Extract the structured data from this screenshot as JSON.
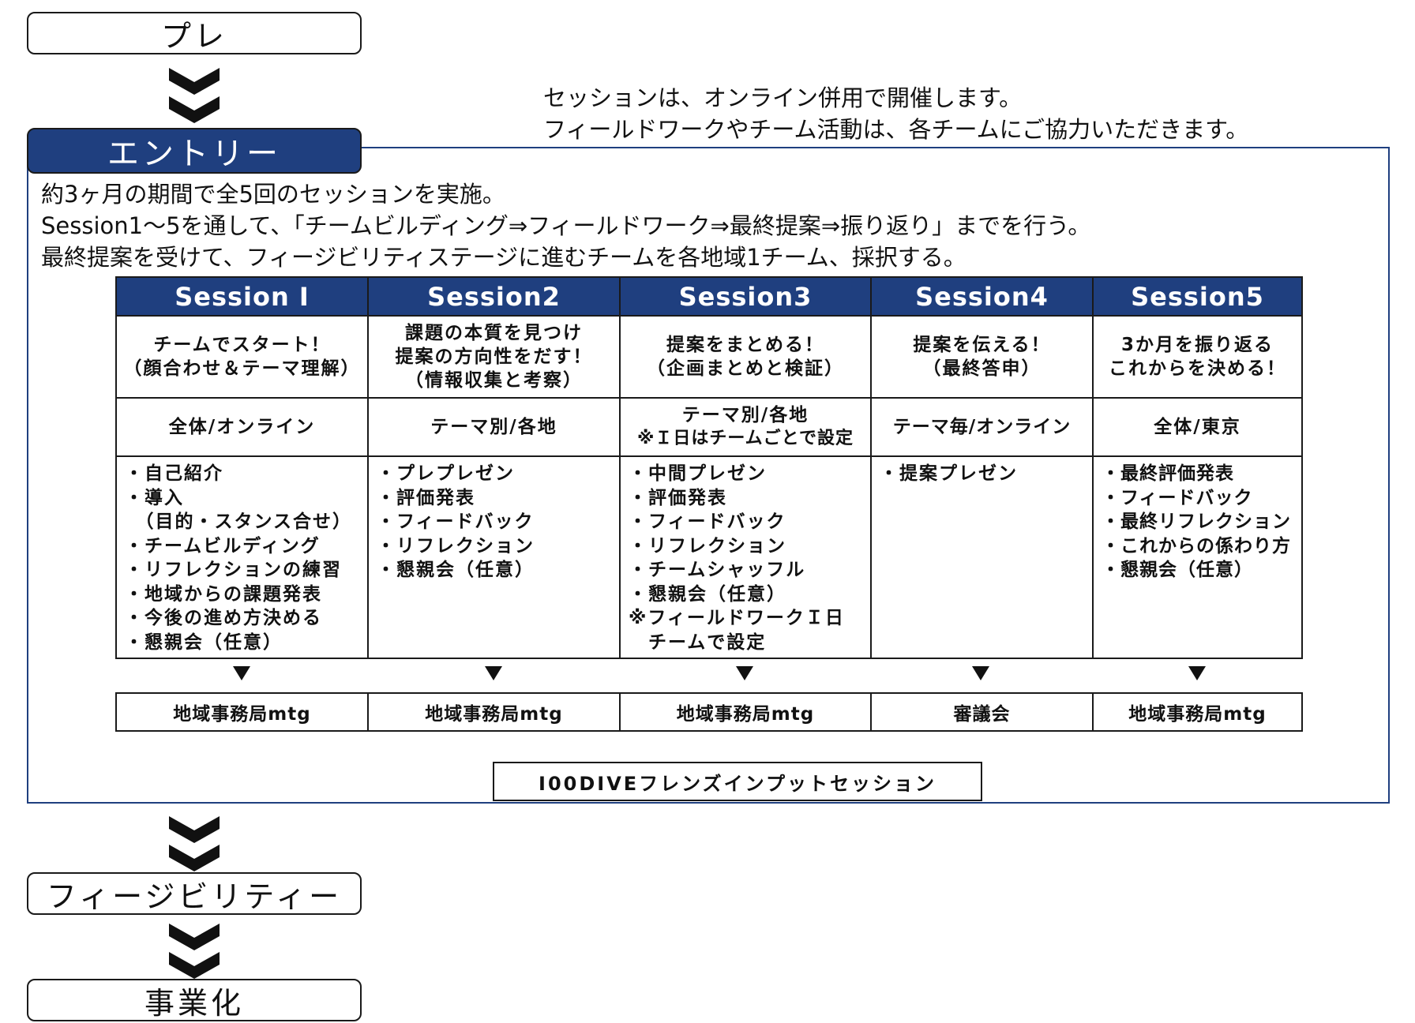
{
  "stages": {
    "pre": "プレ",
    "entry": "エントリー",
    "feasibility": "フィージビリティー",
    "commercialization": "事業化"
  },
  "note": {
    "line1": "セッションは、オンライン併用で開催します。",
    "line2": "フィールドワークやチーム活動は、各チームにご協力いただきます。"
  },
  "intro": {
    "line1": "約3ヶ月の期間で全5回のセッションを実施。",
    "line2": "Session1～5を通して、「チームビルディング⇒フィールドワーク⇒最終提案⇒振り返り」までを行う。",
    "line3": "最終提案を受けて、フィージビリティステージに進むチームを各地域1チーム、採択する。"
  },
  "sessions": [
    {
      "title": "Session I",
      "goal": [
        "チームでスタート！",
        "（顔合わせ＆テーマ理解）"
      ],
      "venue": [
        "全体/オンライン"
      ],
      "activities": [
        "・自己紹介",
        "・導入",
        "　（目的・スタンス合せ）",
        "・チームビルディング",
        "・リフレクションの練習",
        "・地域からの課題発表",
        "・今後の進め方決める",
        "・懇親会（任意）"
      ],
      "after": "地域事務局mtg"
    },
    {
      "title": "Session2",
      "goal": [
        "課題の本質を見つけ",
        "提案の方向性をだす！",
        "（情報収集と考察）"
      ],
      "venue": [
        "テーマ別/各地"
      ],
      "activities": [
        "・プレプレゼン",
        "・評価発表",
        "・フィードバック",
        "・リフレクション",
        "・懇親会（任意）"
      ],
      "after": "地域事務局mtg"
    },
    {
      "title": "Session3",
      "goal": [
        "提案をまとめる！",
        "（企画まとめと検証）"
      ],
      "venue": [
        "テーマ別/各地",
        "※Ｉ日はチームごとで設定"
      ],
      "activities": [
        "・中間プレゼン",
        "・評価発表",
        "・フィードバック",
        "・リフレクション",
        "・チームシャッフル",
        "・懇親会（任意）",
        "※フィールドワークＩ日",
        "　チームで設定"
      ],
      "after": "地域事務局mtg"
    },
    {
      "title": "Session4",
      "goal": [
        "提案を伝える！",
        "（最終答申）"
      ],
      "venue": [
        "テーマ毎/オンライン"
      ],
      "activities": [
        "・提案プレゼン"
      ],
      "after": "審議会"
    },
    {
      "title": "Session5",
      "goal": [
        "3か月を振り返る",
        "これからを決める！"
      ],
      "venue": [
        "全体/東京"
      ],
      "activities": [
        "・最終評価発表",
        "・フィードバック",
        "・最終リフレクション",
        "・これからの係わり方",
        "・懇親会（任意）"
      ],
      "after": "地域事務局mtg"
    }
  ],
  "friends_session": "I00DIVEフレンズインプットセッション",
  "colors": {
    "accent": "#1f3f7f",
    "border": "#1a1a1a",
    "text": "#111111"
  },
  "icons": [
    "double-chevron-down-icon",
    "triangle-down-icon"
  ]
}
